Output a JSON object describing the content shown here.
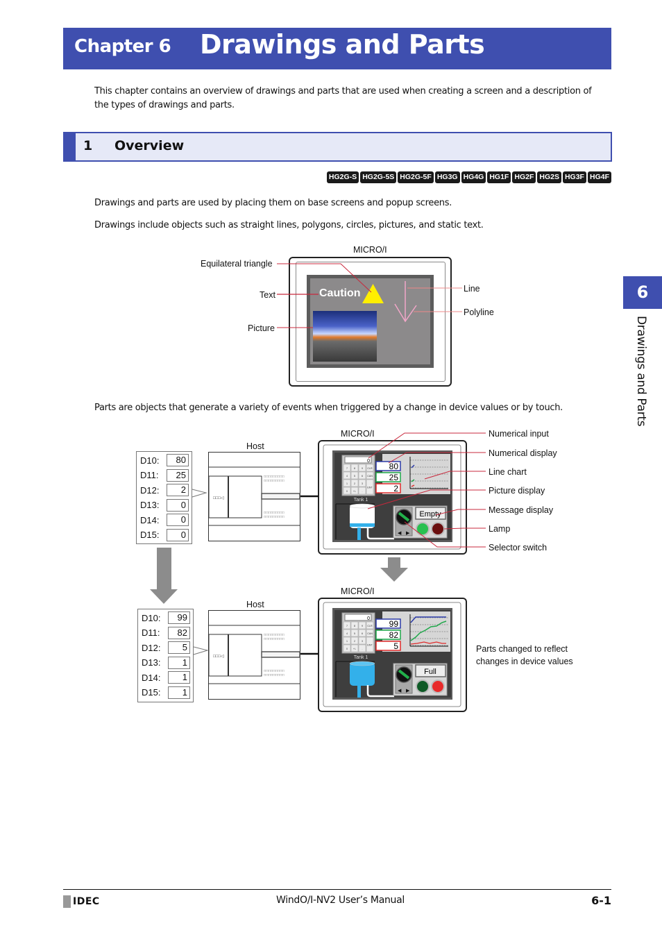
{
  "header": {
    "chapter_label": "Chapter 6",
    "chapter_title": "Drawings and Parts",
    "intro": "This chapter contains an overview of drawings and parts that are used when creating a screen and a description of the types of drawings and parts."
  },
  "section": {
    "number": "1",
    "title": "Overview"
  },
  "badges": [
    "HG2G-S",
    "HG2G-5S",
    "HG2G-5F",
    "HG3G",
    "HG4G",
    "HG1F",
    "HG2F",
    "HG2S",
    "HG3F",
    "HG4F"
  ],
  "paragraphs": {
    "p1": "Drawings and parts are used by placing them on base screens and popup screens.",
    "p2": "Drawings include objects such as straight lines, polygons, circles, pictures, and static text.",
    "p3": "Parts are objects that generate a variety of events when triggered by a change in device values or by touch."
  },
  "drawings_figure": {
    "device_label": "MICRO/I",
    "caution_text": "Caution",
    "callouts": {
      "triangle": "Equilateral triangle",
      "text": "Text",
      "picture": "Picture",
      "line": "Line",
      "polyline": "Polyline"
    },
    "colors": {
      "triangle": "#ffee00",
      "line": "#f2a6c8",
      "callout": "#c8283c"
    }
  },
  "parts_figure": {
    "host_label": "Host",
    "device_label": "MICRO/I",
    "tank_label": "Tank 1",
    "keypad_display": "0",
    "keys": [
      "7",
      "8",
      "9",
      "CLR",
      "4",
      "5",
      "6",
      "CAN",
      "1",
      "2",
      "3",
      "ENT",
      "0",
      "+/-",
      "."
    ],
    "callouts": {
      "numerical_input": "Numerical input",
      "numerical_display": "Numerical display",
      "line_chart": "Line chart",
      "picture_display": "Picture display",
      "message_display": "Message display",
      "lamp": "Lamp",
      "selector_switch": "Selector switch"
    },
    "before": {
      "registers": [
        {
          "label": "D10:",
          "value": "80"
        },
        {
          "label": "D11:",
          "value": "25"
        },
        {
          "label": "D12:",
          "value": "2"
        },
        {
          "label": "D13:",
          "value": "0"
        },
        {
          "label": "D14:",
          "value": "0"
        },
        {
          "label": "D15:",
          "value": "0"
        }
      ],
      "displays": [
        "80",
        "25",
        "2"
      ],
      "message": "Empty",
      "tank_state": "empty",
      "lamps": {
        "green": "on",
        "red": "off"
      }
    },
    "after": {
      "registers": [
        {
          "label": "D10:",
          "value": "99"
        },
        {
          "label": "D11:",
          "value": "82"
        },
        {
          "label": "D12:",
          "value": "5"
        },
        {
          "label": "D13:",
          "value": "1"
        },
        {
          "label": "D14:",
          "value": "1"
        },
        {
          "label": "D15:",
          "value": "1"
        }
      ],
      "displays": [
        "99",
        "82",
        "5"
      ],
      "message": "Full",
      "tank_state": "full",
      "lamps": {
        "green": "off",
        "red": "on"
      }
    },
    "note_line1": "Parts changed to reflect",
    "note_line2": "changes in device values",
    "colors": {
      "blue": "#2b3aa8",
      "green": "#1fa84a",
      "red": "#e02a2a",
      "tank_full": "#33b0ea",
      "callout": "#c8283c"
    }
  },
  "side_tab": {
    "number": "6",
    "text": "Drawings and Parts"
  },
  "footer": {
    "logo": "IDEC",
    "manual": "WindO/I-NV2 User’s Manual",
    "page": "6-1"
  }
}
